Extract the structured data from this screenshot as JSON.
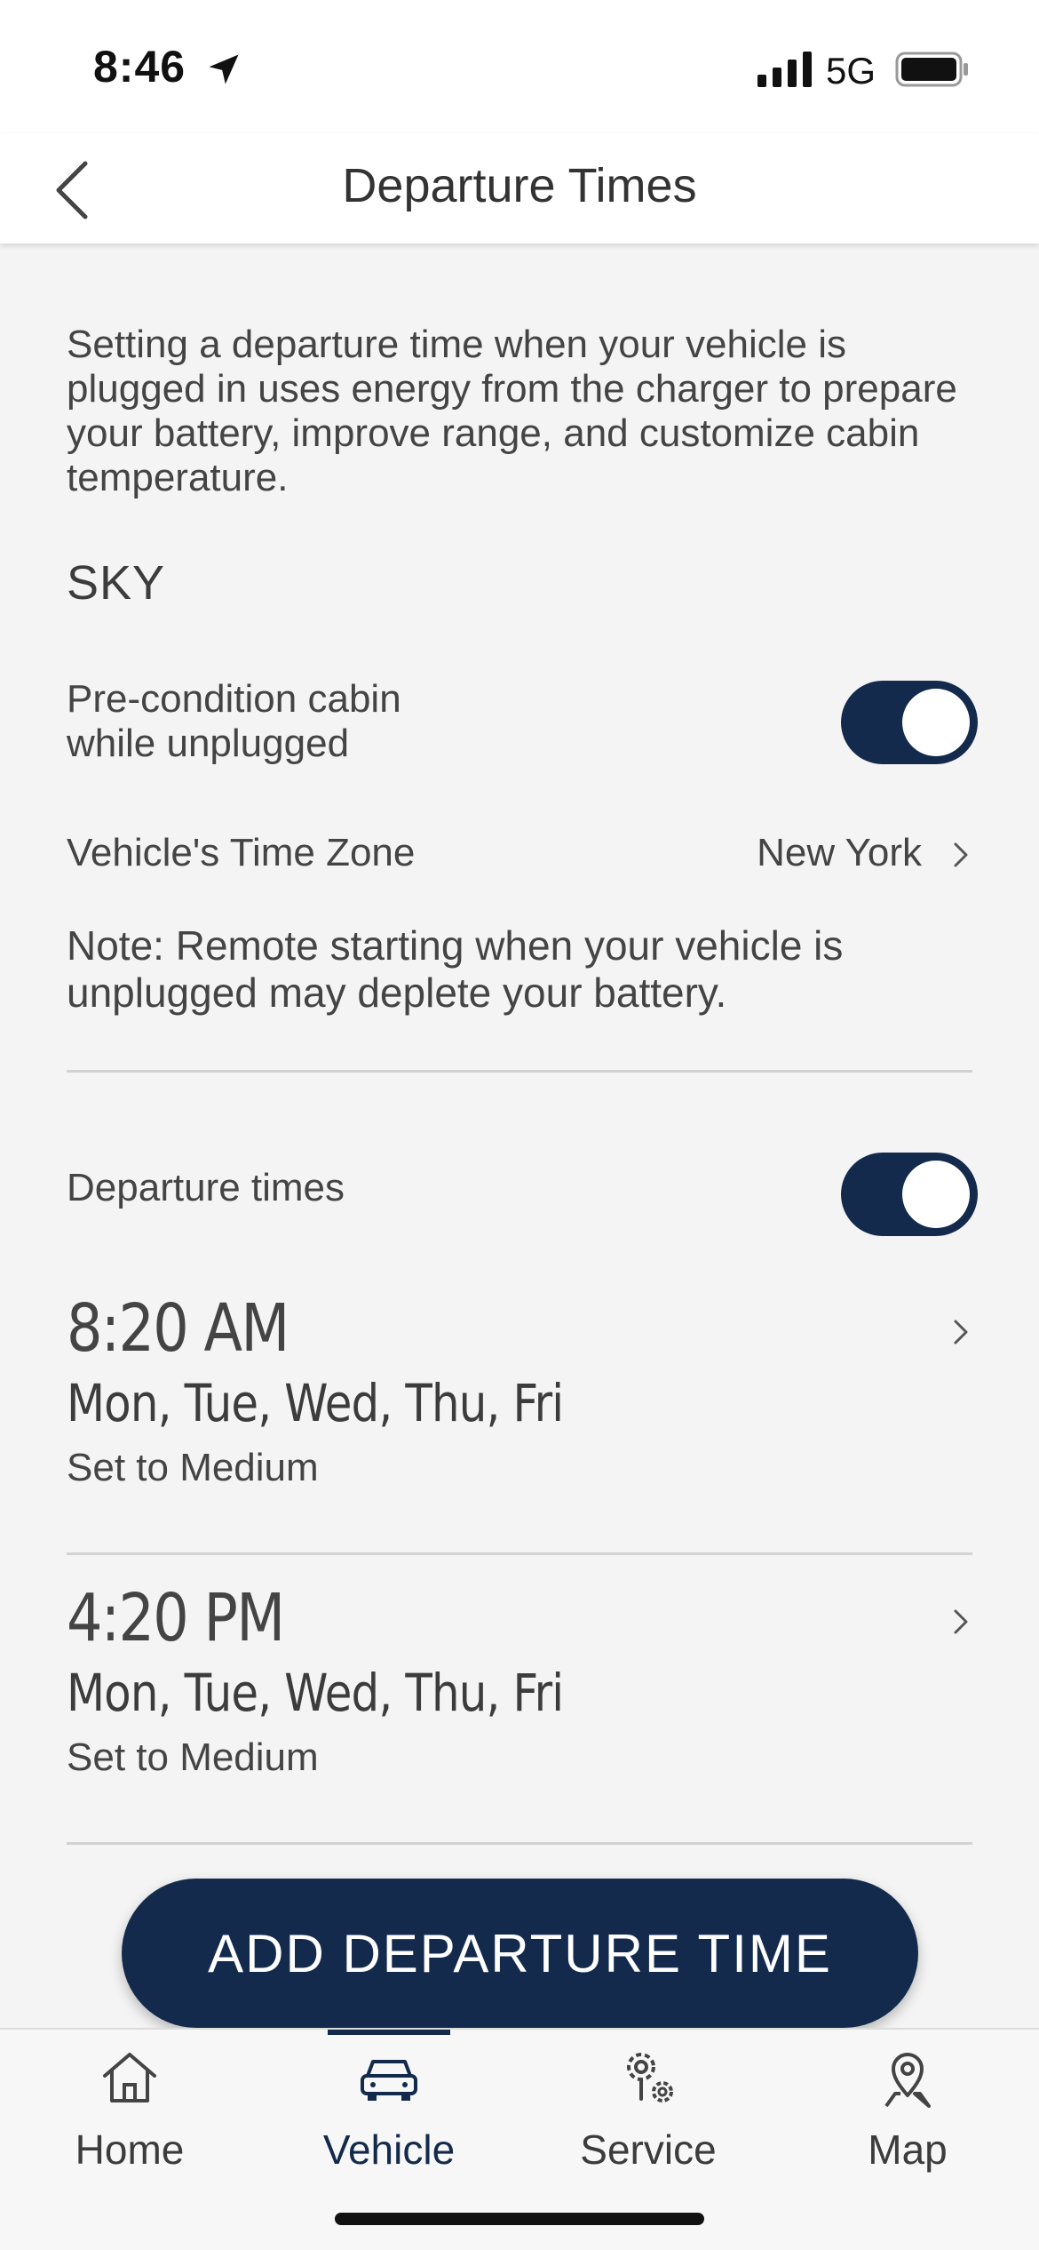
{
  "status_bar": {
    "time": "8:46",
    "network": "5G",
    "icons": [
      "location-arrow-icon",
      "signal-icon",
      "battery-icon"
    ]
  },
  "header": {
    "title": "Departure Times",
    "back_icon": "chevron-left-icon"
  },
  "intro_text": "Setting a departure time when your vehicle is plugged in uses energy from the charger to prepare your battery, improve range, and customize cabin temperature.",
  "vehicle_name": "SKY",
  "precondition": {
    "label_line1": "Pre-condition cabin",
    "label_line2": "while unplugged",
    "enabled": true
  },
  "time_zone": {
    "label": "Vehicle's Time Zone",
    "value": "New York"
  },
  "note": "Note: Remote starting when your vehicle is unplugged may deplete your battery.",
  "departure_toggle": {
    "label": "Departure times",
    "enabled": true
  },
  "departures": [
    {
      "time": "8:20 AM",
      "days": "Mon, Tue, Wed, Thu, Fri",
      "level": "Set to Medium"
    },
    {
      "time": "4:20 PM",
      "days": "Mon, Tue, Wed, Thu, Fri",
      "level": "Set to Medium"
    }
  ],
  "add_button": "ADD DEPARTURE TIME",
  "tabs": [
    {
      "label": "Home",
      "icon": "home-icon",
      "active": false
    },
    {
      "label": "Vehicle",
      "icon": "car-icon",
      "active": true
    },
    {
      "label": "Service",
      "icon": "service-icon",
      "active": false
    },
    {
      "label": "Map",
      "icon": "map-pin-icon",
      "active": false
    }
  ],
  "colors": {
    "accent": "#132a4d",
    "background": "#f4f4f4",
    "header": "#ffffff"
  }
}
